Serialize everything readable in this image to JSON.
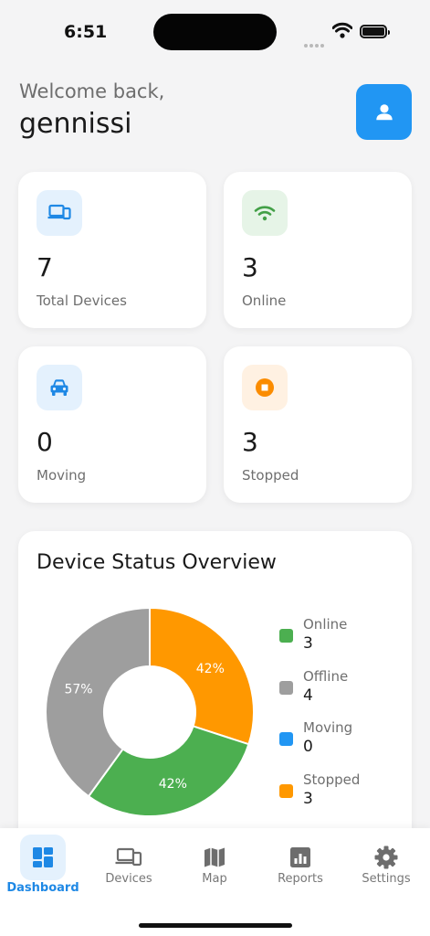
{
  "status_bar": {
    "time": "6:51"
  },
  "header": {
    "welcome": "Welcome back,",
    "username": "gennissi"
  },
  "stats": [
    {
      "value": "7",
      "label": "Total Devices",
      "icon": "devices-icon",
      "color": "#1e88e5",
      "bg": "#e4f1fd"
    },
    {
      "value": "3",
      "label": "Online",
      "icon": "wifi-icon",
      "color": "#43a047",
      "bg": "#e6f4e7"
    },
    {
      "value": "0",
      "label": "Moving",
      "icon": "car-icon",
      "color": "#1e88e5",
      "bg": "#e4f1fd"
    },
    {
      "value": "3",
      "label": "Stopped",
      "icon": "stop-icon",
      "color": "#fb8c00",
      "bg": "#fff1e2"
    }
  ],
  "chart": {
    "title": "Device Status Overview"
  },
  "chart_data": {
    "type": "pie",
    "donut": true,
    "title": "Device Status Overview",
    "slices": [
      {
        "label": "Online",
        "value": 3,
        "percent_label": "42%",
        "color": "#4caf50"
      },
      {
        "label": "Offline",
        "value": 4,
        "percent_label": "57%",
        "color": "#9e9e9e"
      },
      {
        "label": "Moving",
        "value": 0,
        "percent_label": "",
        "color": "#2196f3"
      },
      {
        "label": "Stopped",
        "value": 3,
        "percent_label": "42%",
        "color": "#ff9800"
      }
    ],
    "legend_placement": "right"
  },
  "nav": [
    {
      "label": "Dashboard",
      "icon": "dashboard-icon",
      "active": true
    },
    {
      "label": "Devices",
      "icon": "devices-icon",
      "active": false
    },
    {
      "label": "Map",
      "icon": "map-icon",
      "active": false
    },
    {
      "label": "Reports",
      "icon": "reports-icon",
      "active": false
    },
    {
      "label": "Settings",
      "icon": "settings-icon",
      "active": false
    }
  ]
}
